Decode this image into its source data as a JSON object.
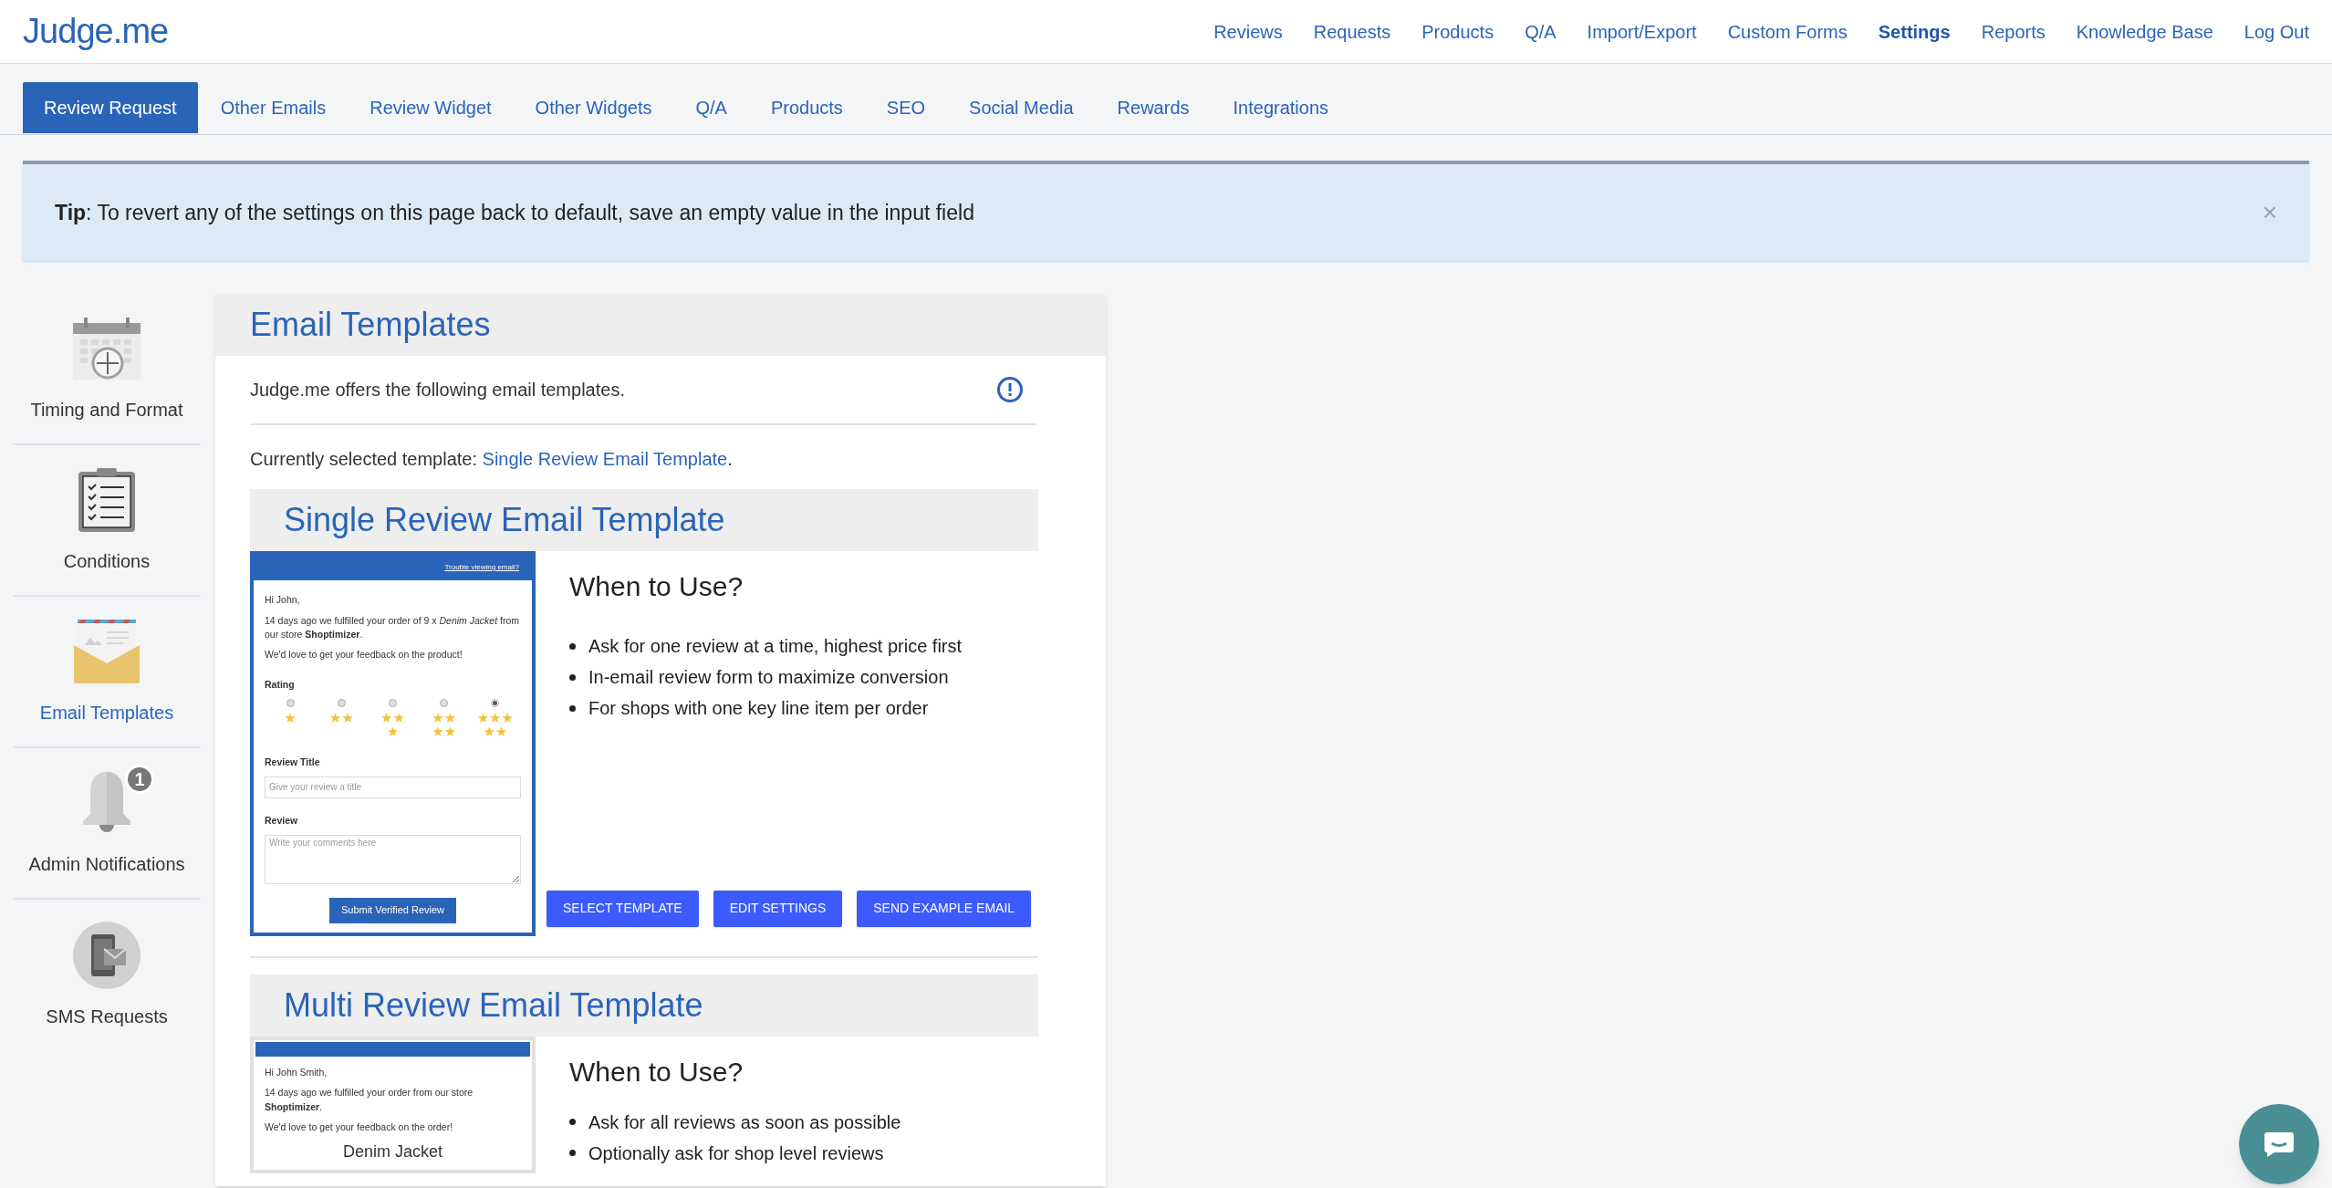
{
  "header": {
    "logo": "Judge.me",
    "nav": [
      {
        "label": "Reviews",
        "selected": false
      },
      {
        "label": "Requests",
        "selected": false
      },
      {
        "label": "Products",
        "selected": false
      },
      {
        "label": "Q/A",
        "selected": false
      },
      {
        "label": "Import/Export",
        "selected": false
      },
      {
        "label": "Custom Forms",
        "selected": false
      },
      {
        "label": "Settings",
        "selected": true
      },
      {
        "label": "Reports",
        "selected": false
      },
      {
        "label": "Knowledge Base",
        "selected": false
      },
      {
        "label": "Log Out",
        "selected": false
      }
    ]
  },
  "tabs": [
    {
      "label": "Review Request",
      "selected": true
    },
    {
      "label": "Other Emails",
      "selected": false
    },
    {
      "label": "Review Widget",
      "selected": false
    },
    {
      "label": "Other Widgets",
      "selected": false
    },
    {
      "label": "Q/A",
      "selected": false
    },
    {
      "label": "Products",
      "selected": false
    },
    {
      "label": "SEO",
      "selected": false
    },
    {
      "label": "Social Media",
      "selected": false
    },
    {
      "label": "Rewards",
      "selected": false
    },
    {
      "label": "Integrations",
      "selected": false
    }
  ],
  "tip": {
    "text": "**Tip**: To revert any of the settings on this page back to default, save an empty value in the input field",
    "close": "×"
  },
  "sidebar": {
    "items": [
      {
        "kind": "calendar",
        "label": "Timing and Format",
        "selected": false
      },
      {
        "kind": "clipboard",
        "label": "Conditions",
        "selected": false
      },
      {
        "kind": "envelope",
        "label": "Email Templates",
        "selected": true
      },
      {
        "kind": "bell",
        "label": "Admin Notifications",
        "selected": false,
        "badge": "1"
      },
      {
        "kind": "phone",
        "label": "SMS Requests",
        "selected": false
      }
    ]
  },
  "card": {
    "title": "Email Templates",
    "intro": "Judge.me offers the following email templates.",
    "current_prefix": "Currently selected template: ",
    "current_link": "Single Review Email Template",
    "current_suffix": ".",
    "templates": [
      {
        "title": "Single Review Email Template",
        "preview": {
          "top_link": "Trouble viewing email?",
          "greeting": "Hi John,",
          "body": "14 days ago we fulfilled your order of 9 x *Denim Jacket* from our store **Shoptimizer**.",
          "line": "We'd love to get your feedback on the product!",
          "rating_label": "Rating",
          "ratings": [
            {
              "label": "★",
              "selected": false
            },
            {
              "label": "★★",
              "selected": false
            },
            {
              "label": "★★★",
              "selected": false
            },
            {
              "label": "★★★★",
              "selected": false
            },
            {
              "label": "★★★★★",
              "selected": true
            }
          ],
          "title_label": "Review Title",
          "title_placeholder": "Give your review a title",
          "review_label": "Review",
          "review_placeholder": "Write your comments here",
          "submit": "Submit Verified Review"
        },
        "when_title": "When to Use?",
        "bullets": [
          "Ask for one review at a time, highest price first",
          "In-email review form to maximize conversion",
          "For shops with one key line item per order"
        ],
        "buttons": [
          "SELECT TEMPLATE",
          "EDIT SETTINGS",
          "SEND EXAMPLE EMAIL"
        ]
      },
      {
        "title": "Multi Review Email Template",
        "preview": {
          "greeting": "Hi John Smith,",
          "body": "14 days ago we fulfilled your order from our store **Shoptimizer**.",
          "line": "We'd love to get your feedback on the order!",
          "product": "Denim Jacket"
        },
        "when_title": "When to Use?",
        "bullets": [
          "Ask for all reviews as soon as possible",
          "Optionally ask for shop level reviews"
        ]
      }
    ]
  }
}
